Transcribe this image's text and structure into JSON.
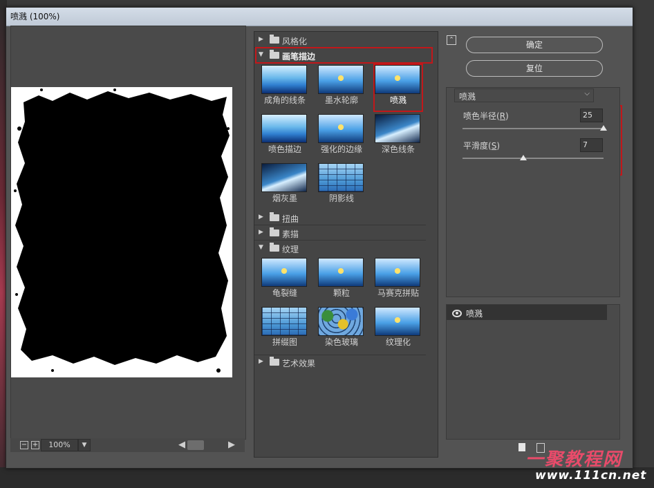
{
  "window": {
    "title": "喷溅 (100%)"
  },
  "preview": {
    "zoom": "100%",
    "zoom_out": "−",
    "zoom_in": "+"
  },
  "gallery": {
    "categories": [
      {
        "label": "风格化",
        "expanded": false
      },
      {
        "label": "画笔描边",
        "expanded": true
      },
      {
        "label": "扭曲",
        "expanded": false
      },
      {
        "label": "素描",
        "expanded": false
      },
      {
        "label": "纹理",
        "expanded": true
      },
      {
        "label": "艺术效果",
        "expanded": false
      }
    ],
    "brush_filters": [
      "成角的线条",
      "墨水轮廓",
      "喷溅",
      "喷色描边",
      "强化的边缘",
      "深色线条",
      "烟灰墨",
      "阴影线"
    ],
    "texture_filters": [
      "龟裂缝",
      "颗粒",
      "马赛克拼贴",
      "拼缀图",
      "染色玻璃",
      "纹理化"
    ],
    "selected": "喷溅"
  },
  "buttons": {
    "ok": "确定",
    "reset": "复位"
  },
  "settings": {
    "filter": "喷溅",
    "params": [
      {
        "label": "喷色半径",
        "key": "R",
        "value": "25",
        "level": 1.0
      },
      {
        "label": "平滑度",
        "key": "S",
        "value": "7",
        "level": 0.43
      }
    ]
  },
  "layers": {
    "items": [
      {
        "name": "喷溅"
      }
    ]
  },
  "watermark": {
    "line1": "一聚教程网",
    "line2": "www.111cn.net"
  },
  "colors": {
    "highlight": "#c2171a",
    "panel": "#535353",
    "titlebar": "#c7d1dd"
  }
}
